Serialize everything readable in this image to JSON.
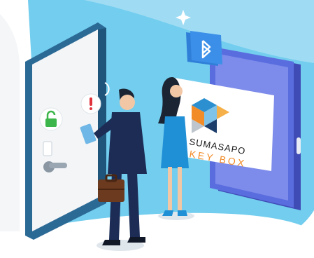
{
  "logo": {
    "line1": "SUMASAPO",
    "line2": "KEY BOX"
  },
  "colors": {
    "sky": "#6cc9ec",
    "sky_light": "#a9e1f5",
    "door_frame": "#2f6f9a",
    "door_panel": "#f3f5f7",
    "phone_body": "#5567d9",
    "phone_dark": "#3f4cb6",
    "bluetooth": "#2f7fd8",
    "lock_green": "#3cb64a",
    "alert_red": "#e0323c",
    "suit_navy": "#1c2c55",
    "dress_blue": "#1f8fd6",
    "logo_orange": "#f28c28"
  },
  "icons": [
    "bluetooth-icon",
    "unlock-icon",
    "alert-icon"
  ]
}
